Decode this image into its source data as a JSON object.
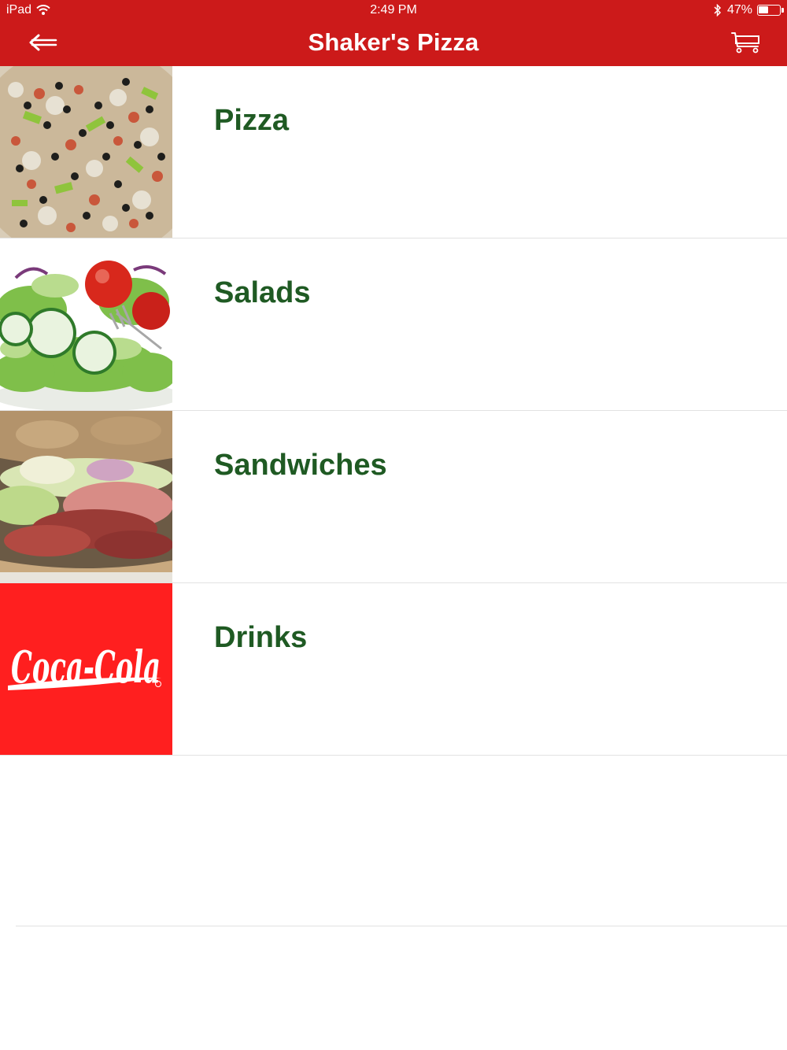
{
  "status_bar": {
    "device": "iPad",
    "time": "2:49 PM",
    "battery": "47%",
    "battery_level": 0.47
  },
  "nav": {
    "title": "Shaker's Pizza",
    "back_icon": "back-arrow-icon",
    "cart_icon": "cart-icon"
  },
  "categories": [
    {
      "label": "Pizza",
      "image": "pizza-photo"
    },
    {
      "label": "Salads",
      "image": "salad-photo"
    },
    {
      "label": "Sandwiches",
      "image": "sandwich-photo"
    },
    {
      "label": "Drinks",
      "image": "coca-cola-logo",
      "logo_text": "Coca-Cola"
    }
  ],
  "colors": {
    "brand_red": "#cc1a1a",
    "label_green": "#1f5a23",
    "coke_red": "#ff1f1f"
  }
}
